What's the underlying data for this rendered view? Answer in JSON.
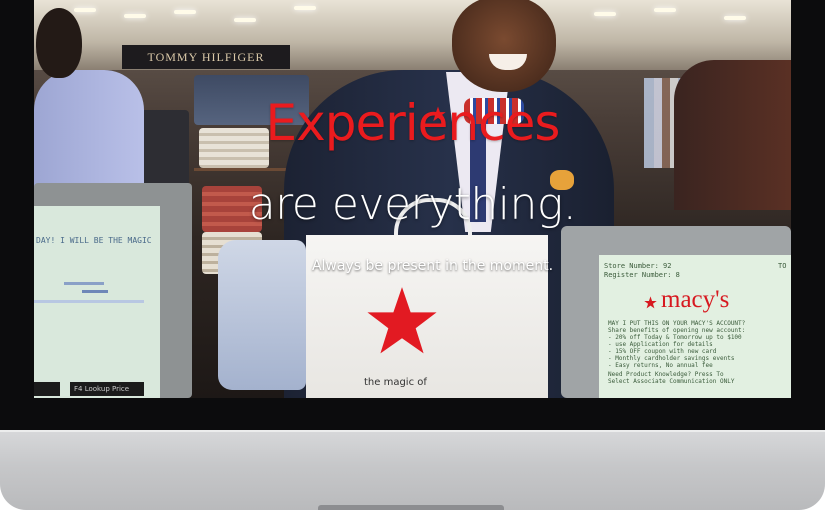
{
  "store_sign": "TOMMY HILFIGER",
  "headline": "Experiences",
  "subhead": "are everything.",
  "tagline": "Always be present in the moment.",
  "left_register": {
    "banner": "DAY! I WILL BE THE MAGIC",
    "buttons": [
      "",
      "F4 Lookup Price"
    ]
  },
  "right_register": {
    "store_number": "Store Number: 92",
    "register_number": "Register Number: 8",
    "logo": "macy's",
    "prompt_lines": [
      "MAY I PUT THIS ON YOUR MACY'S ACCOUNT?",
      "Share benefits of opening new account:",
      "- 20% off Today & Tomorrow up to $100",
      "- use Application for details",
      "- 15% OFF coupon with new card",
      "- Monthly cardholder savings events",
      "- Easy returns, No annual fee",
      "Need Product Knowledge? Press To",
      "Select Associate Communication ONLY"
    ],
    "side_text": "TO"
  },
  "bag_text": "the magic of",
  "colors": {
    "brand_red": "#ea1b1e",
    "bezel": "#0c0c0d",
    "chin": "#c6c7c9"
  }
}
